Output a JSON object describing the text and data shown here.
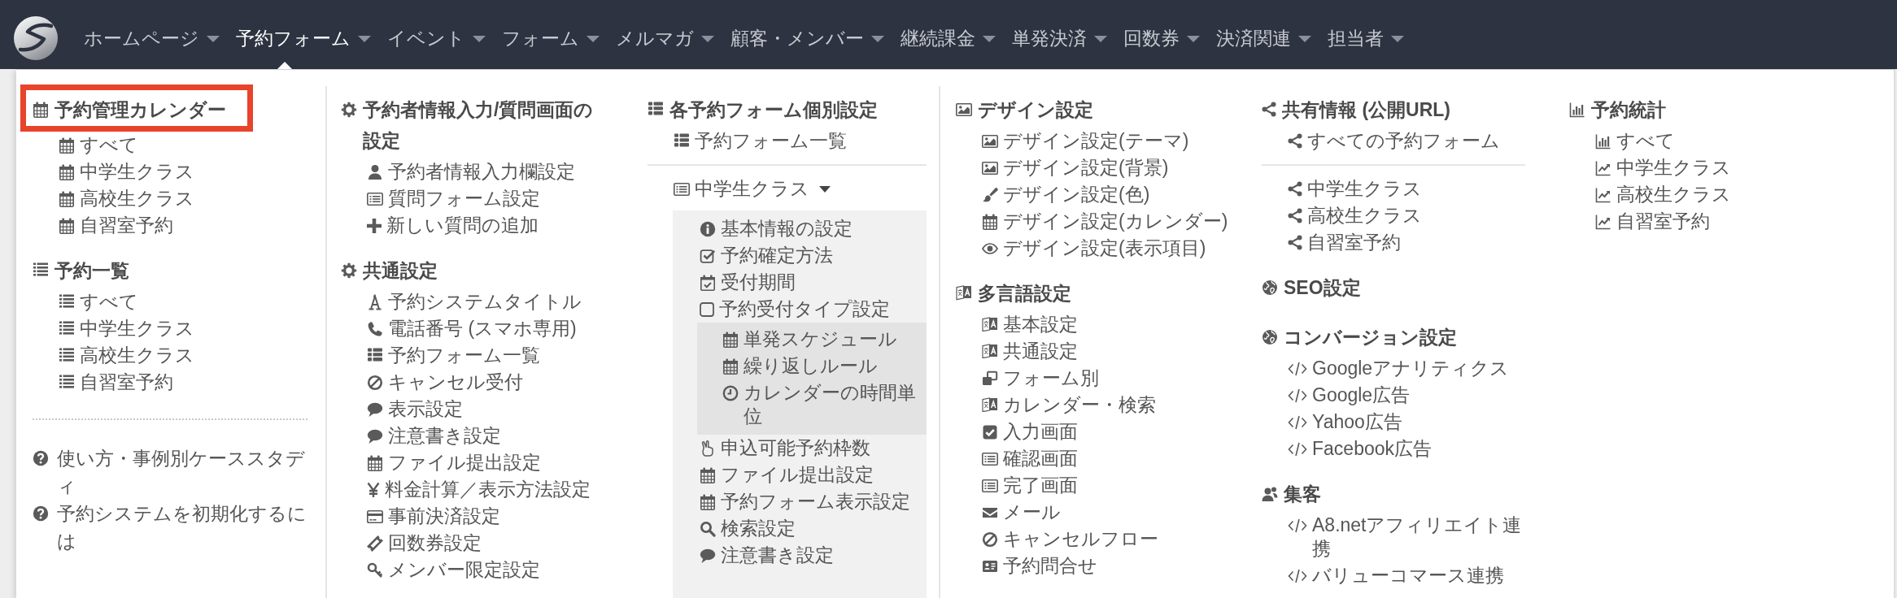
{
  "navbar": {
    "items": [
      {
        "label": "ホームページ",
        "selected": false
      },
      {
        "label": "予約フォーム",
        "selected": true
      },
      {
        "label": "イベント",
        "selected": false
      },
      {
        "label": "フォーム",
        "selected": false
      },
      {
        "label": "メルマガ",
        "selected": false
      },
      {
        "label": "顧客・メンバー",
        "selected": false
      },
      {
        "label": "継続課金",
        "selected": false
      },
      {
        "label": "単発決済",
        "selected": false
      },
      {
        "label": "回数券",
        "selected": false
      },
      {
        "label": "決済関連",
        "selected": false
      },
      {
        "label": "担当者",
        "selected": false
      }
    ]
  },
  "menu": {
    "columns": [
      {
        "blocks": [
          {
            "kind": "section",
            "heading": {
              "kind": "calendar",
              "title": "予約管理カレンダー",
              "highlighted": true
            },
            "items": [
              {
                "kind": "calendar",
                "label": "すべて"
              },
              {
                "kind": "calendar",
                "label": "中学生クラス"
              },
              {
                "kind": "calendar",
                "label": "高校生クラス"
              },
              {
                "kind": "calendar",
                "label": "自習室予約"
              }
            ]
          },
          {
            "kind": "section",
            "heading": {
              "kind": "list",
              "title": "予約一覧",
              "highlighted": false
            },
            "items": [
              {
                "kind": "list",
                "label": "すべて"
              },
              {
                "kind": "list",
                "label": "中学生クラス"
              },
              {
                "kind": "list",
                "label": "高校生クラス"
              },
              {
                "kind": "list",
                "label": "自習室予約"
              }
            ]
          },
          {
            "kind": "dotted_rule"
          },
          {
            "kind": "links",
            "items": [
              {
                "kind": "question",
                "label": "使い方・事例別ケーススタディ"
              },
              {
                "kind": "question",
                "label": "予約システムを初期化するには"
              }
            ]
          }
        ]
      },
      {
        "blocks": [
          {
            "kind": "section",
            "heading": {
              "kind": "gear",
              "title": "予約者情報入力/質問画面の設定",
              "highlighted": false
            },
            "items": [
              {
                "kind": "user",
                "label": "予約者情報入力欄設定"
              },
              {
                "kind": "form",
                "label": "質問フォーム設定"
              },
              {
                "kind": "plus",
                "label": "新しい質問の追加"
              }
            ]
          },
          {
            "kind": "section",
            "heading": {
              "kind": "gear",
              "title": "共通設定",
              "highlighted": false
            },
            "items": [
              {
                "kind": "font",
                "label": "予約システムタイトル"
              },
              {
                "kind": "phone",
                "label": "電話番号 (スマホ専用)"
              },
              {
                "kind": "thlist",
                "label": "予約フォーム一覧"
              },
              {
                "kind": "ban",
                "label": "キャンセル受付"
              },
              {
                "kind": "comment",
                "label": "表示設定"
              },
              {
                "kind": "comment",
                "label": "注意書き設定"
              },
              {
                "kind": "calendar",
                "label": "ファイル提出設定"
              },
              {
                "kind": "yen",
                "label": "料金計算／表示方法設定"
              },
              {
                "kind": "card",
                "label": "事前決済設定"
              },
              {
                "kind": "ticket",
                "label": "回数券設定"
              },
              {
                "kind": "key",
                "label": "メンバー限定設定"
              }
            ]
          }
        ]
      },
      {
        "blocks": [
          {
            "kind": "section",
            "heading": {
              "kind": "thlist",
              "title": "各予約フォーム個別設定",
              "highlighted": false
            },
            "items": [
              {
                "kind": "thlist",
                "label": "予約フォーム一覧"
              }
            ]
          },
          {
            "kind": "rule"
          },
          {
            "kind": "group",
            "toggle": {
              "kind": "form",
              "label": "中学生クラス"
            },
            "expanded": true,
            "items": [
              {
                "kind": "info",
                "label": "基本情報の設定"
              },
              {
                "kind": "checkbox",
                "label": "予約確定方法"
              },
              {
                "kind": "calendarcheck",
                "label": "受付期間"
              },
              {
                "kind": "square",
                "label": "予約受付タイプ設定",
                "children": [
                  {
                    "kind": "calendar",
                    "label": "単発スケジュール"
                  },
                  {
                    "kind": "calendar",
                    "label": "繰り返しルール"
                  },
                  {
                    "kind": "clock",
                    "label": "カレンダーの時間単位"
                  }
                ]
              },
              {
                "kind": "hand",
                "label": "申込可能予約枠数"
              },
              {
                "kind": "calendar",
                "label": "ファイル提出設定"
              },
              {
                "kind": "calendar",
                "label": "予約フォーム表示設定"
              },
              {
                "kind": "search",
                "label": "検索設定"
              },
              {
                "kind": "comment",
                "label": "注意書き設定"
              }
            ]
          }
        ]
      },
      {
        "blocks": [
          {
            "kind": "section",
            "heading": {
              "kind": "image",
              "title": "デザイン設定",
              "highlighted": false
            },
            "items": [
              {
                "kind": "image",
                "label": "デザイン設定(テーマ)"
              },
              {
                "kind": "image",
                "label": "デザイン設定(背景)"
              },
              {
                "kind": "brush",
                "label": "デザイン設定(色)"
              },
              {
                "kind": "calendar",
                "label": "デザイン設定(カレンダー)"
              },
              {
                "kind": "eye",
                "label": "デザイン設定(表示項目)"
              }
            ]
          },
          {
            "kind": "section",
            "heading": {
              "kind": "translate",
              "title": "多言語設定",
              "highlighted": false
            },
            "items": [
              {
                "kind": "translate",
                "label": "基本設定"
              },
              {
                "kind": "translate",
                "label": "共通設定"
              },
              {
                "kind": "windows",
                "label": "フォーム別"
              },
              {
                "kind": "translate",
                "label": "カレンダー・検索"
              },
              {
                "kind": "checked",
                "label": "入力画面"
              },
              {
                "kind": "form",
                "label": "確認画面"
              },
              {
                "kind": "form",
                "label": "完了画面"
              },
              {
                "kind": "envelope",
                "label": "メール"
              },
              {
                "kind": "ban",
                "label": "キャンセルフロー"
              },
              {
                "kind": "idcard",
                "label": "予約問合せ"
              }
            ]
          }
        ]
      },
      {
        "blocks": [
          {
            "kind": "section",
            "heading": {
              "kind": "share",
              "title": "共有情報 (公開URL)",
              "highlighted": false
            },
            "items": [
              {
                "kind": "share",
                "label": "すべての予約フォーム"
              }
            ]
          },
          {
            "kind": "rule"
          },
          {
            "kind": "section",
            "items": [
              {
                "kind": "share",
                "label": "中学生クラス"
              },
              {
                "kind": "share",
                "label": "高校生クラス"
              },
              {
                "kind": "share",
                "label": "自習室予約"
              }
            ]
          },
          {
            "kind": "section",
            "heading": {
              "kind": "globe",
              "title": "SEO設定",
              "highlighted": false
            }
          },
          {
            "kind": "section",
            "heading": {
              "kind": "globe",
              "title": "コンバージョン設定",
              "highlighted": false
            },
            "items": [
              {
                "kind": "code",
                "label": "Googleアナリティクス"
              },
              {
                "kind": "code",
                "label": "Google広告"
              },
              {
                "kind": "code",
                "label": "Yahoo広告"
              },
              {
                "kind": "code",
                "label": "Facebook広告"
              }
            ]
          },
          {
            "kind": "section",
            "heading": {
              "kind": "users",
              "title": "集客",
              "highlighted": false
            },
            "items": [
              {
                "kind": "code",
                "label": "A8.netアフィリエイト連携"
              },
              {
                "kind": "code",
                "label": "バリューコマース連携"
              }
            ]
          }
        ]
      },
      {
        "blocks": [
          {
            "kind": "section",
            "heading": {
              "kind": "barchart",
              "title": "予約統計",
              "highlighted": false
            },
            "items": [
              {
                "kind": "barchart",
                "label": "すべて"
              },
              {
                "kind": "linechart",
                "label": "中学生クラス"
              },
              {
                "kind": "linechart",
                "label": "高校生クラス"
              },
              {
                "kind": "linechart",
                "label": "自習室予約"
              }
            ]
          }
        ]
      }
    ]
  }
}
